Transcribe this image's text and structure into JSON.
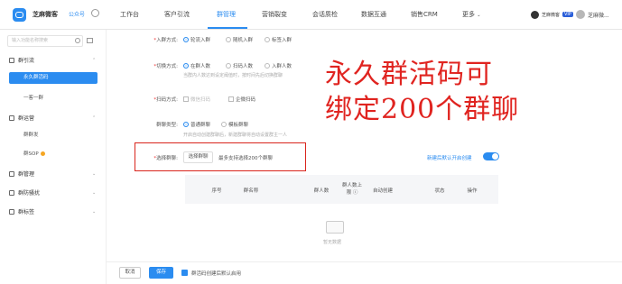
{
  "topbar": {
    "brand": "芝麻微客",
    "brand_tag": "公众号",
    "nav": [
      "工作台",
      "客户引流",
      "群管理",
      "营销裂变",
      "会话质检",
      "数据互通",
      "销售CRM",
      "更多"
    ],
    "user": {
      "badge": "芝麻微客",
      "vip": "VIP",
      "name": "芝麻微..."
    }
  },
  "sidebar": {
    "search_placeholder": "输入功能名称搜索",
    "groups": [
      {
        "title": "群引流",
        "items": [
          "永久群活码",
          "一客一群"
        ]
      },
      {
        "title": "群运营",
        "items": [
          "群群发",
          "群SOP"
        ]
      },
      {
        "title": "群管理",
        "items": []
      },
      {
        "title": "群防骚扰",
        "items": []
      },
      {
        "title": "群标签",
        "items": []
      }
    ]
  },
  "form": {
    "join_mode": {
      "label": "入群方式:",
      "options": [
        "轮流入群",
        "随机入群",
        "标签入群"
      ]
    },
    "switch_mode": {
      "label": "切换方式:",
      "options": [
        "在群人数",
        "扫码人数",
        "入群人数"
      ],
      "hint": "当群内人数达到设定阈值时，按时间先后切换群聊"
    },
    "code_mode": {
      "label": "扫码方式:",
      "options": [
        "微信扫码",
        "企微扫码"
      ]
    },
    "group_type": {
      "label": "群聊类型:",
      "options": [
        "普通群聊",
        "模板群聊"
      ],
      "hint": "开启自动创建群聊后，新建群聊将自动设置群主一人"
    },
    "select_group": {
      "label": "选择群聊:",
      "button": "选择群聊",
      "hint": "最多支持选择200个群聊"
    },
    "toggle_label": "新建后默认开启创建",
    "table_headers": [
      "序号",
      "群名称",
      "群人数",
      "群人数上限",
      "自动创建",
      "状态",
      "操作"
    ],
    "empty_text": "暂无数据"
  },
  "overlay": {
    "line1": "永久群活码可",
    "line2": "绑定200个群聊"
  },
  "footer": {
    "cancel": "取消",
    "save": "保存",
    "check_text": "群活码创建后默认启用"
  }
}
